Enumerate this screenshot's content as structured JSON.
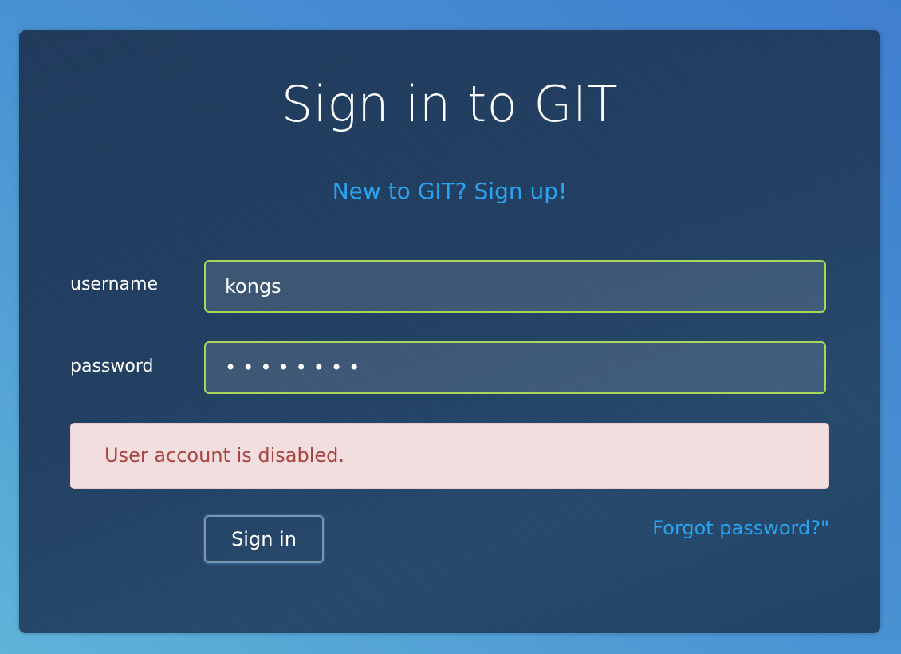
{
  "form": {
    "title": "Sign in to GIT",
    "signup_link": "New to GIT? Sign up!",
    "username_label": "username",
    "username_value": "kongs",
    "password_label": "password",
    "password_value": "••••••••",
    "error_message": "User account is disabled.",
    "signin_button": "Sign in",
    "forgot_link": "Forgot password?\""
  },
  "colors": {
    "link": "#2aa3f0",
    "field_border": "#a7d65a",
    "alert_background": "#f2dede",
    "alert_text": "#a94442",
    "panel_background": "#213f62"
  }
}
